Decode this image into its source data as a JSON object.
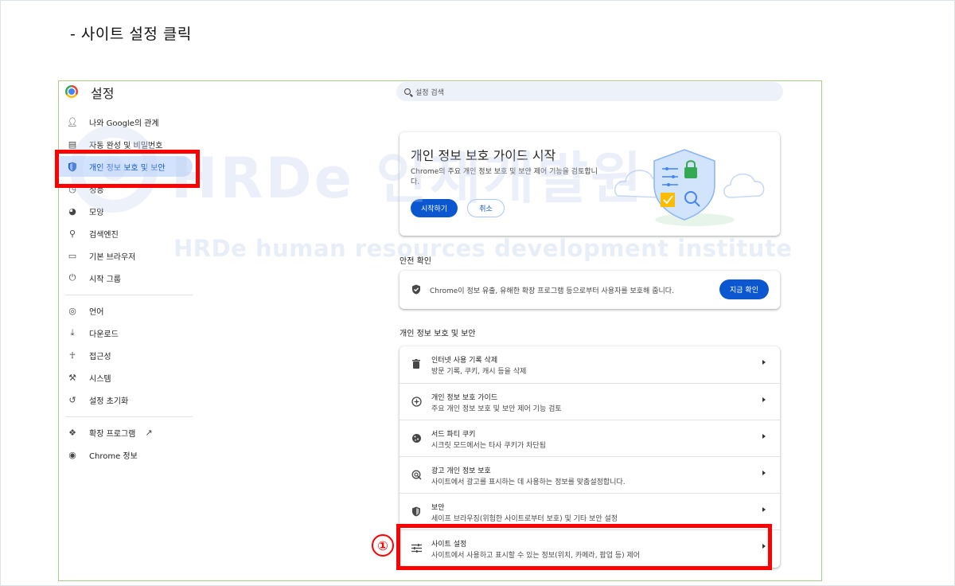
{
  "caption": "- 사이트 설정 클릭",
  "app": {
    "title": "설정",
    "search_placeholder": "설정 검색"
  },
  "sidebar": {
    "items": [
      {
        "label": "나와 Google의 관계",
        "icon": "person-icon"
      },
      {
        "label": "자동 완성 및 비밀번호",
        "icon": "clipboard-icon"
      },
      {
        "label": "개인 정보 보호 및 보안",
        "icon": "shield-icon",
        "active": true
      },
      {
        "label": "성능",
        "icon": "speed-icon"
      },
      {
        "label": "모양",
        "icon": "palette-icon"
      },
      {
        "label": "검색엔진",
        "icon": "search-icon"
      },
      {
        "label": "기본 브라우저",
        "icon": "browser-icon"
      },
      {
        "label": "시작 그룹",
        "icon": "power-icon"
      },
      {
        "label": "언어",
        "icon": "globe-icon"
      },
      {
        "label": "다운로드",
        "icon": "download-icon"
      },
      {
        "label": "접근성",
        "icon": "accessibility-icon"
      },
      {
        "label": "시스템",
        "icon": "wrench-icon"
      },
      {
        "label": "설정 초기화",
        "icon": "restore-icon"
      },
      {
        "label": "확장 프로그램",
        "icon": "puzzle-icon"
      },
      {
        "label": "Chrome 정보",
        "icon": "chrome-icon"
      }
    ]
  },
  "guide": {
    "title": "개인 정보 보호 가이드 시작",
    "description": "Chrome의 주요 개인 정보 보호 및 보안 제어 기능을 검토합니다.",
    "start_label": "시작하기",
    "cancel_label": "취소"
  },
  "safety": {
    "heading": "안전 확인",
    "text": "Chrome이 정보 유출, 유해한 확장 프로그램 등으로부터 사용자를 보호해 줍니다.",
    "button_label": "지금 확인"
  },
  "privacy": {
    "heading": "개인 정보 보호 및 보안",
    "rows": [
      {
        "title": "인터넷 사용 기록 삭제",
        "subtitle": "방문 기록, 쿠키, 캐시 등을 삭제",
        "icon": "trash-icon"
      },
      {
        "title": "개인 정보 보호 가이드",
        "subtitle": "주요 개인 정보 보호 및 보안 제어 기능 검토",
        "icon": "compass-icon"
      },
      {
        "title": "서드 파티 쿠키",
        "subtitle": "시크릿 모드에서는 타사 쿠키가 차단됨",
        "icon": "cookie-icon"
      },
      {
        "title": "광고 개인 정보 보호",
        "subtitle": "사이트에서 광고를 표시하는 데 사용하는 정보를 맞춤설정합니다.",
        "icon": "ad-privacy-icon"
      },
      {
        "title": "보안",
        "subtitle": "세이프 브라우징(위험한 사이트로부터 보호) 및 기타 보안 설정",
        "icon": "shield-icon"
      },
      {
        "title": "사이트 설정",
        "subtitle": "사이트에서 사용하고 표시할 수 있는 정보(위치, 카메라, 팝업 등) 제어",
        "icon": "sliders-icon"
      }
    ]
  },
  "watermark": {
    "main": "HRDe 인재개발원",
    "sub": "HRDe human resources development institute"
  },
  "annotation": {
    "step": "①",
    "color": "#ff0000"
  },
  "colors": {
    "accent": "#0b57d0",
    "active_bg": "#d3e3fd",
    "search_bg": "#edf2fa"
  }
}
